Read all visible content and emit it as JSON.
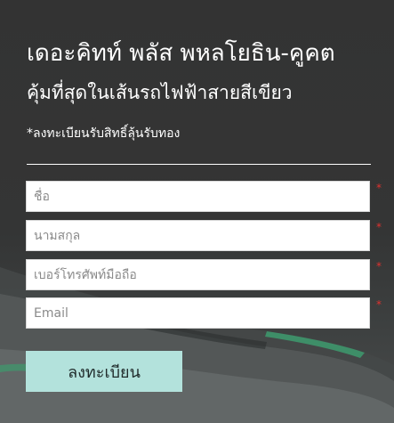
{
  "header": {
    "title": "เดอะคิทท์ พลัส พหลโยธิน-คูคต",
    "subtitle": "คุ้มที่สุดในเส้นรถไฟฟ้าสายสีเขียว",
    "note": "*ลงทะเบียนรับสิทธิ์ลุ้นรับทอง"
  },
  "form": {
    "first_name": {
      "placeholder": "ชื่อ",
      "value": "",
      "required_mark": "*"
    },
    "last_name": {
      "placeholder": "นามสกุล",
      "value": "",
      "required_mark": "*"
    },
    "phone": {
      "placeholder": "เบอร์โทรศัพท์มือถือ",
      "value": "",
      "required_mark": "*"
    },
    "email": {
      "placeholder": "Email",
      "value": "",
      "required_mark": "*"
    },
    "submit_label": "ลงทะเบียน"
  },
  "colors": {
    "background": "#343535",
    "text": "#ffffff",
    "button": "#b3e2dc",
    "required": "#e0322f"
  }
}
